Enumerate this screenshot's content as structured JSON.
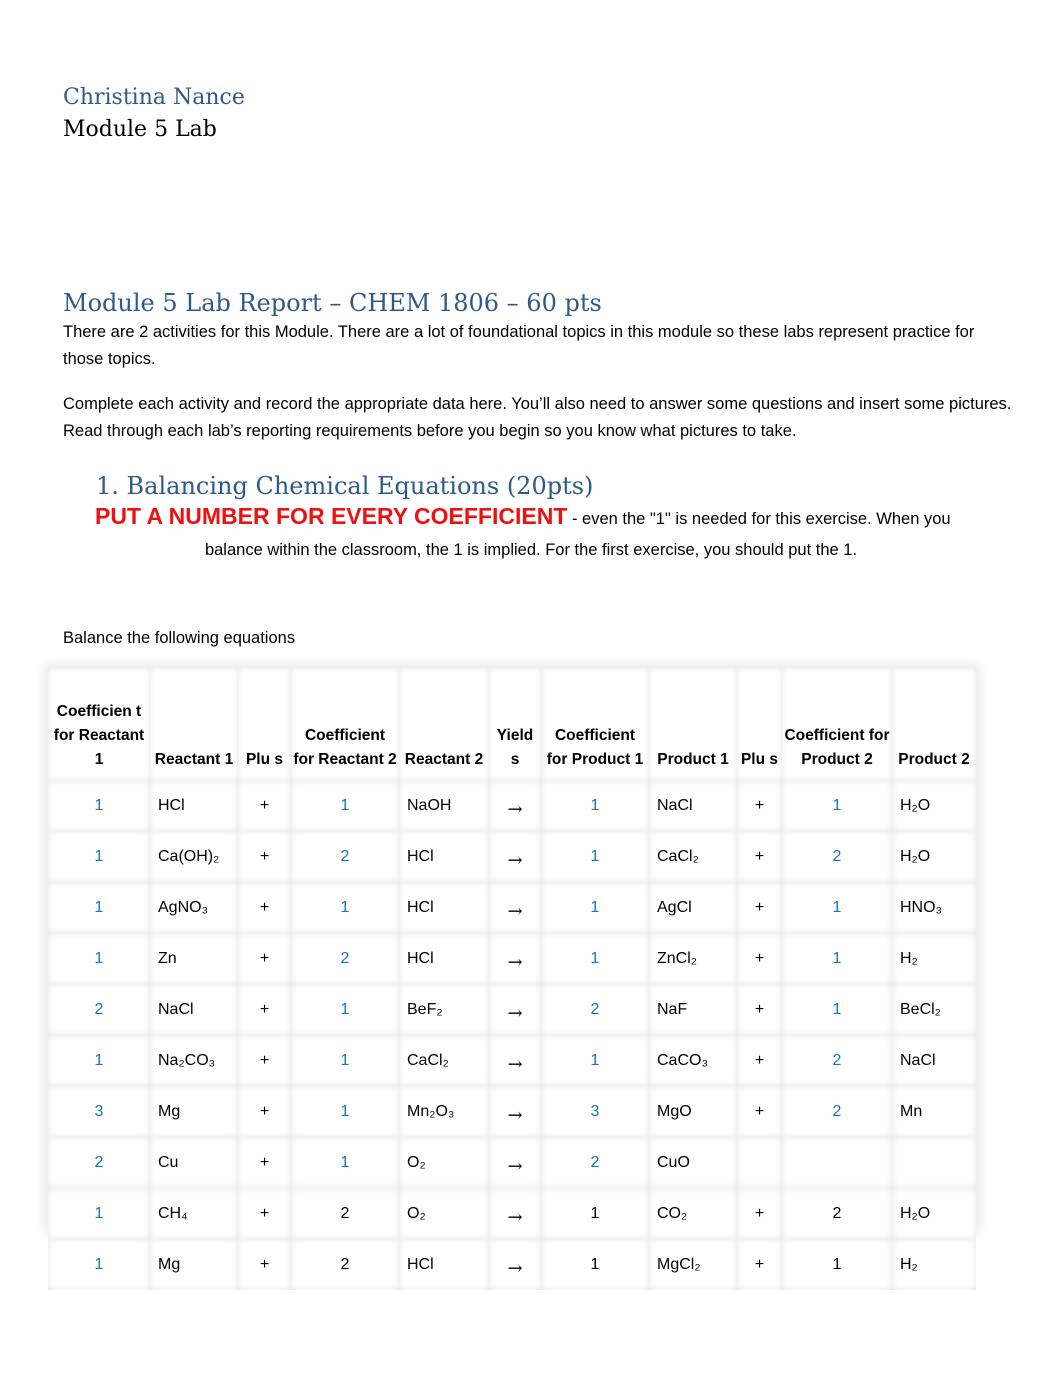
{
  "header": {
    "author": "Christina Nance",
    "subtitle": "Module 5 Lab"
  },
  "report": {
    "title": "Module 5 Lab Report – CHEM 1806 – 60 pts",
    "paragraph1": "There are 2 activities for this Module.  There are a lot of foundational topics in this module so these labs represent practice for those topics.",
    "paragraph2": "Complete each activity and record the appropriate data here. You’ll also need to answer some questions and insert some pictures. Read through each lab’s reporting requirements before you begin so you know what pictures to take."
  },
  "section1": {
    "heading": "1.  Balancing Chemical Equations (20pts)",
    "warning": "PUT A NUMBER FOR EVERY COEFFICIENT",
    "warning_rest": " - even the \"1\" is needed for this exercise. When you",
    "warning_line2": "balance within the classroom, the 1 is implied. For the first exercise, you should put the 1.",
    "instruction": "Balance the following equations"
  },
  "colors": {
    "heading_blue": "#2e5a8a",
    "warning_red": "#ee1111",
    "answer_blue": "#1a73c0"
  },
  "table": {
    "headers": [
      "Coefficien t for Reactant 1",
      "Reactant 1",
      "Plu s",
      "Coefficient for Reactant 2",
      "Reactant 2",
      "Yield s",
      "Coefficient for Product 1",
      "Product 1",
      "Plu s",
      "Coefficient for Product 2",
      "Product 2"
    ],
    "rows": [
      {
        "c1": "1",
        "r1": "HCl",
        "plus1": "+",
        "c2": "1",
        "r2": "NaOH",
        "yields": "→",
        "c3": "1",
        "p1": "NaCl",
        "plus2": "+",
        "c4": "1",
        "p2": "H₂O"
      },
      {
        "c1": "1",
        "r1": "Ca(OH)₂",
        "plus1": "+",
        "c2": "2",
        "r2": "HCl",
        "yields": "→",
        "c3": "1",
        "p1": "CaCl₂",
        "plus2": "+",
        "c4": "2",
        "p2": "H₂O"
      },
      {
        "c1": "1",
        "r1": "AgNO₃",
        "plus1": "+",
        "c2": "1",
        "r2": "HCl",
        "yields": "→",
        "c3": "1",
        "p1": "AgCl",
        "plus2": "+",
        "c4": "1",
        "p2": "HNO₃"
      },
      {
        "c1": "1",
        "r1": "Zn",
        "plus1": "+",
        "c2": "2",
        "r2": "HCl",
        "yields": "→",
        "c3": "1",
        "p1": "ZnCl₂",
        "plus2": "+",
        "c4": "1",
        "p2": "H₂"
      },
      {
        "c1": "2",
        "r1": "NaCl",
        "plus1": "+",
        "c2": "1",
        "r2": "BeF₂",
        "yields": "→",
        "c3": "2",
        "p1": "NaF",
        "plus2": "+",
        "c4": "1",
        "p2": "BeCl₂"
      },
      {
        "c1": "1",
        "r1": "Na₂CO₃",
        "plus1": "+",
        "c2": "1",
        "r2": "CaCl₂",
        "yields": "→",
        "c3": "1",
        "p1": "CaCO₃",
        "plus2": "+",
        "c4": "2",
        "p2": "NaCl"
      },
      {
        "c1": "3",
        "r1": "Mg",
        "plus1": "+",
        "c2": "1",
        "r2": "Mn₂O₃",
        "yields": "→",
        "c3": "3",
        "p1": "MgO",
        "plus2": "+",
        "c4": "2",
        "p2": "Mn"
      },
      {
        "c1": "2",
        "r1": "Cu",
        "plus1": "+",
        "c2": "1",
        "r2": "O₂",
        "yields": "→",
        "c3": "2",
        "p1": "CuO",
        "plus2": "",
        "c4": "",
        "p2": ""
      },
      {
        "c1": "1",
        "r1": "CH₄",
        "plus1": "+",
        "c2": "2",
        "r2": "O₂",
        "yields": "→",
        "c3": "1",
        "p1": "CO₂",
        "plus2": "+",
        "c4": "2",
        "p2": "H₂O"
      },
      {
        "c1": "1",
        "r1": "Mg",
        "plus1": "+",
        "c2": "2",
        "r2": "HCl",
        "yields": "→",
        "c3": "1",
        "p1": "MgCl₂",
        "plus2": "+",
        "c4": "1",
        "p2": "H₂"
      }
    ],
    "blue_cells": [
      {
        "c1": true,
        "c2": true,
        "c3": true,
        "c4": true
      },
      {
        "c1": true,
        "c2": true,
        "c3": true,
        "c4": true
      },
      {
        "c1": true,
        "c2": true,
        "c3": true,
        "c4": true
      },
      {
        "c1": true,
        "c2": true,
        "c3": true,
        "c4": true
      },
      {
        "c1": true,
        "c2": true,
        "c3": true,
        "c4": true
      },
      {
        "c1": true,
        "c2": true,
        "c3": true,
        "c4": true
      },
      {
        "c1": true,
        "c2": true,
        "c3": true,
        "c4": true
      },
      {
        "c1": true,
        "c2": true,
        "c3": true,
        "c4": false
      },
      {
        "c1": true,
        "c2": false,
        "c3": false,
        "c4": false
      },
      {
        "c1": true,
        "c2": false,
        "c3": false,
        "c4": false
      }
    ]
  }
}
